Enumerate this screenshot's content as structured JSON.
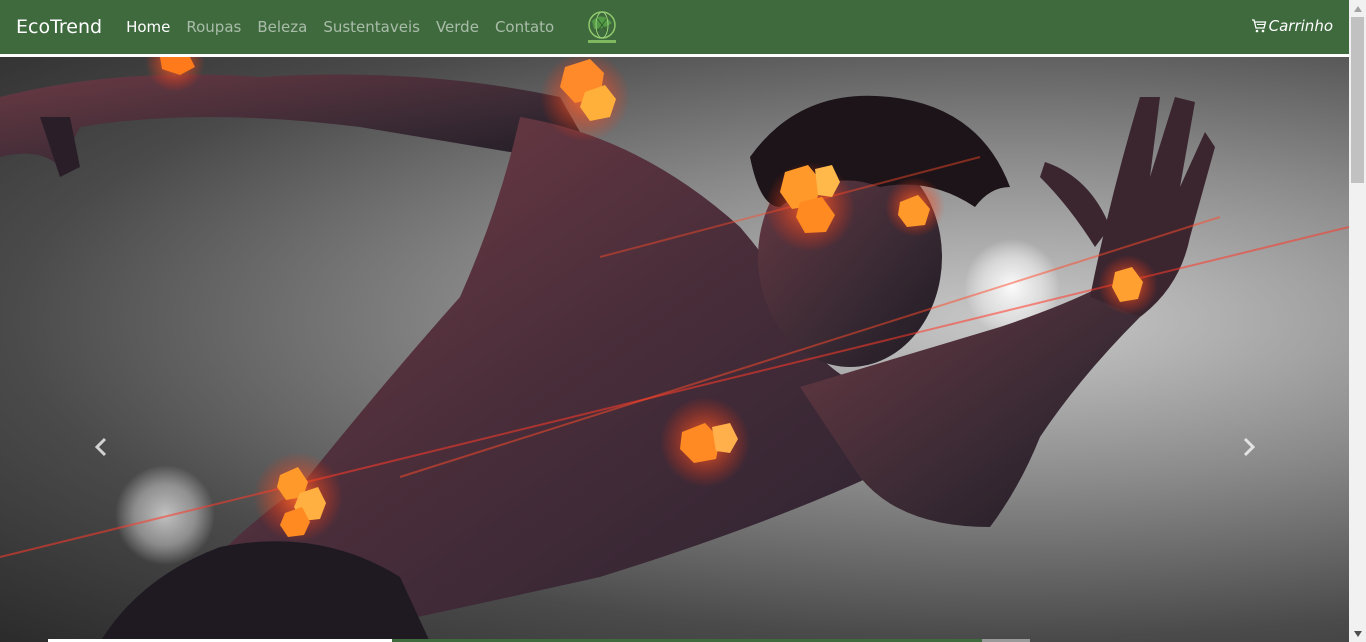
{
  "navbar": {
    "brand": "EcoTrend",
    "links": [
      {
        "label": "Home",
        "active": true
      },
      {
        "label": "Roupas",
        "active": false
      },
      {
        "label": "Beleza",
        "active": false
      },
      {
        "label": "Sustentaveis",
        "active": false
      },
      {
        "label": "Verde",
        "active": false
      },
      {
        "label": "Contato",
        "active": false
      }
    ],
    "logo_icon": "ecotrend-globe-logo",
    "cart_icon": "shopping-cart-icon",
    "cart_label": "Carrinho"
  },
  "carousel": {
    "prev_icon": "chevron-left-icon",
    "next_icon": "chevron-right-icon",
    "slide_count": 3,
    "active_slide": 1
  },
  "colors": {
    "navbar_bg": "#3f6a3e",
    "accent_glow": "#ff4a1a",
    "hex_orange": "#ff8a1f"
  }
}
